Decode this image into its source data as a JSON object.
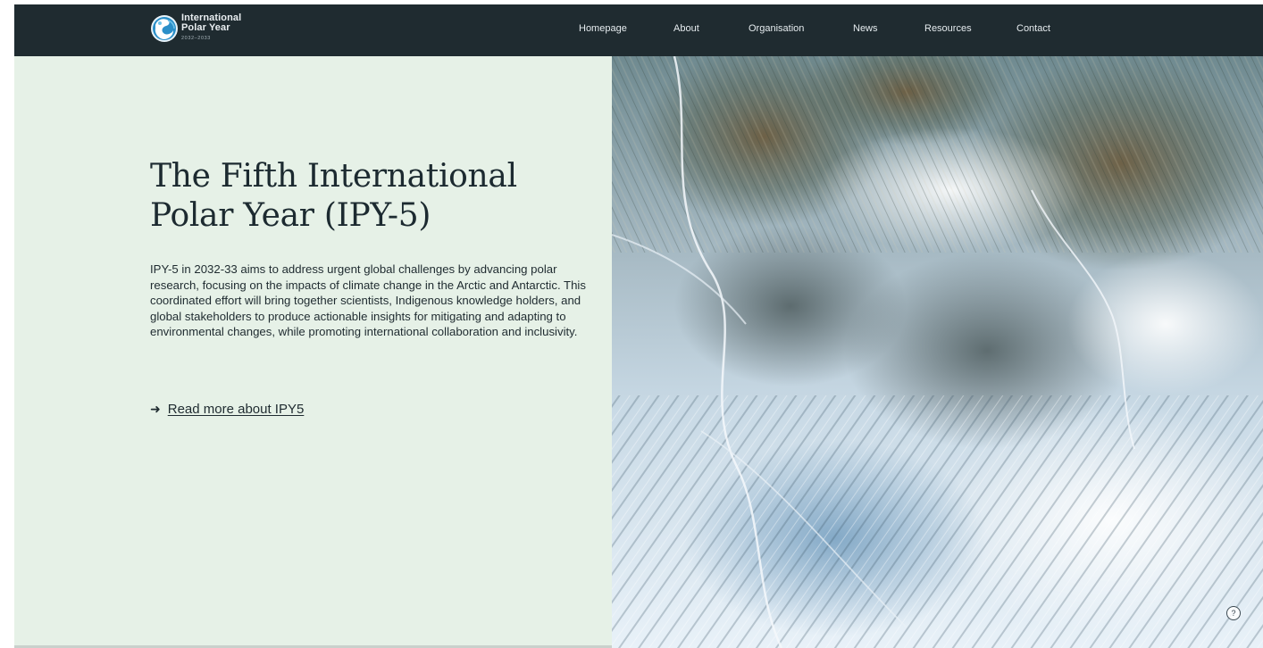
{
  "logo": {
    "line1": "International",
    "line2": "Polar Year",
    "line3": "2032–2033",
    "colors": {
      "outer": "#2b8fc9",
      "inner": "#ffffff",
      "accent": "#6fc3ea"
    }
  },
  "nav": {
    "items": [
      {
        "label": "Homepage"
      },
      {
        "label": "About"
      },
      {
        "label": "Organisation"
      },
      {
        "label": "News"
      },
      {
        "label": "Resources"
      },
      {
        "label": "Contact"
      }
    ]
  },
  "hero": {
    "title": "The Fifth International Polar Year (IPY-5)",
    "body": "IPY-5 in 2032-33 aims to address urgent global challenges by advancing polar research, focusing on the impacts of climate change in the Arctic and Antarctic. This coordinated effort will bring together scientists, Indigenous knowledge holders, and global stakeholders to produce actionable insights for mitigating and adapting to environmental changes, while promoting international collaboration and inclusivity.",
    "cta_arrow": "➜",
    "cta_label": "Read more about IPY5"
  },
  "help": {
    "label": "?"
  },
  "colors": {
    "header_bg": "#1f2b30",
    "hero_bg": "#e6f1e7",
    "text": "#1c2a30"
  },
  "icons": {
    "logo": "globe-logo-icon",
    "cta": "arrow-right-icon",
    "help": "question-circle-icon"
  }
}
